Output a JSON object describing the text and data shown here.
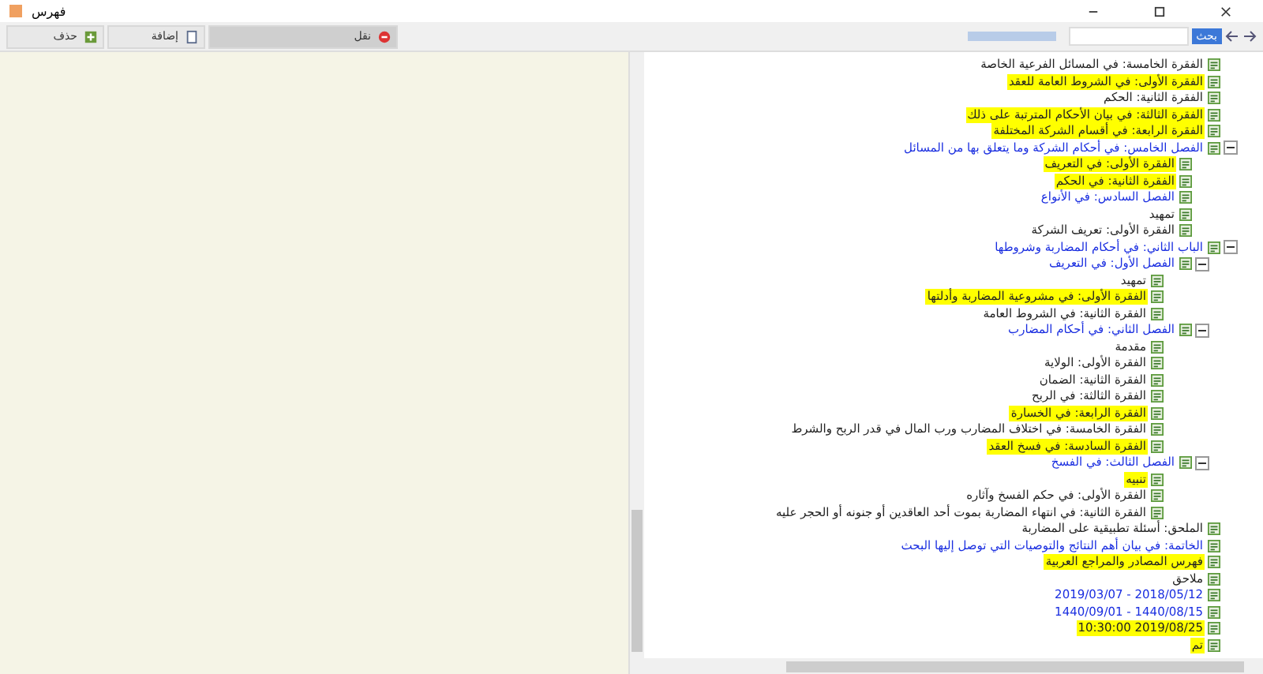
{
  "window": {
    "title": "فهرس"
  },
  "toolbar": {
    "buttons": [
      {
        "label": "نقل",
        "kind": "pressed"
      },
      {
        "label": "إضافة",
        "kind": "edit"
      },
      {
        "label": "حذف",
        "kind": "add"
      }
    ],
    "progress": {
      "level": 1
    },
    "find_label": "بحث"
  },
  "tree": {
    "items": [
      {
        "label": "الفقرة الخامسة: في المسائل الفرعية الخاصة",
        "kind": "text",
        "highlighted": false
      },
      {
        "label": "الفقرة الأولى: في الشروط العامة للعقد",
        "kind": "text",
        "highlighted": true
      },
      {
        "label": "الفقرة الثانية: الحكم",
        "kind": "text",
        "highlighted": false
      },
      {
        "label": "الفقرة الثالثة: في بيان الأحكام المترتبة على ذلك",
        "kind": "text",
        "highlighted": true
      },
      {
        "label": "الفقرة الرابعة: في أقسام الشركة المختلفة",
        "kind": "text",
        "highlighted": true
      },
      {
        "label": "الفصل الخامس: في أحكام الشركة وما يتعلق بها من المسائل",
        "kind": "heading",
        "highlighted": false,
        "expanded": true,
        "children": [
          {
            "label": "الفقرة الأولى: في التعريف",
            "kind": "text",
            "highlighted": true
          },
          {
            "label": "الفقرة الثانية: في الحكم",
            "kind": "text",
            "highlighted": true
          },
          {
            "label": "الفصل السادس: في الأنواع",
            "kind": "heading",
            "highlighted": false
          },
          {
            "label": "تمهيد",
            "kind": "text",
            "highlighted": false
          },
          {
            "label": "الفقرة الأولى: تعريف الشركة",
            "kind": "text",
            "highlighted": false
          }
        ]
      },
      {
        "label": "الباب الثاني: في أحكام المضاربة وشروطها",
        "kind": "heading",
        "highlighted": false,
        "expanded": true,
        "children": [
          {
            "label": "الفصل الأول: في التعريف",
            "kind": "heading",
            "highlighted": false,
            "expanded": true,
            "children": [
              {
                "label": "تمهيد",
                "kind": "text",
                "highlighted": false
              },
              {
                "label": "الفقرة الأولى: في مشروعية المضاربة وأدلتها",
                "kind": "text",
                "highlighted": true
              },
              {
                "label": "الفقرة الثانية: في الشروط العامة",
                "kind": "text",
                "highlighted": false
              }
            ]
          },
          {
            "label": "الفصل الثاني: في أحكام المضارب",
            "kind": "heading",
            "highlighted": false,
            "expanded": true,
            "children": [
              {
                "label": "مقدمة",
                "kind": "text",
                "highlighted": false
              },
              {
                "label": "الفقرة الأولى: الولاية",
                "kind": "text",
                "highlighted": false
              },
              {
                "label": "الفقرة الثانية: الضمان",
                "kind": "text",
                "highlighted": false
              },
              {
                "label": "الفقرة الثالثة: في الربح",
                "kind": "text",
                "highlighted": false
              },
              {
                "label": "الفقرة الرابعة: في الخسارة",
                "kind": "text",
                "highlighted": true
              },
              {
                "label": "الفقرة الخامسة: في اختلاف المضارب ورب المال في قدر الربح والشرط",
                "kind": "text",
                "highlighted": false
              },
              {
                "label": "الفقرة السادسة: في فسخ العقد",
                "kind": "text",
                "highlighted": true
              }
            ]
          },
          {
            "label": "الفصل الثالث: في الفسخ",
            "kind": "heading",
            "highlighted": false,
            "expanded": true,
            "children": [
              {
                "label": "تنبيه",
                "kind": "text",
                "highlighted": true
              },
              {
                "label": "الفقرة الأولى: في حكم الفسخ وآثاره",
                "kind": "text",
                "highlighted": false
              },
              {
                "label": "الفقرة الثانية: في انتهاء المضاربة بموت أحد العاقدين أو جنونه أو الحجر عليه",
                "kind": "text",
                "highlighted": false
              }
            ]
          }
        ]
      },
      {
        "label": "الملحق: أسئلة تطبيقية على المضاربة",
        "kind": "text",
        "highlighted": false
      },
      {
        "label": "الخاتمة: في بيان أهم النتائج والتوصيات التي توصل إليها البحث",
        "kind": "heading",
        "highlighted": false
      },
      {
        "label": "فهرس المصادر والمراجع العربية",
        "kind": "text",
        "highlighted": true
      },
      {
        "label": "ملاحق",
        "kind": "text",
        "highlighted": false
      },
      {
        "label": "2018/05/12 - 2019/03/07",
        "kind": "heading",
        "highlighted": false
      },
      {
        "label": "1440/08/15 - 1440/09/01",
        "kind": "heading",
        "highlighted": false
      },
      {
        "label": "2019/08/25 10:30:00",
        "kind": "text",
        "highlighted": true
      },
      {
        "label": "تم",
        "kind": "text",
        "highlighted": true
      }
    ]
  }
}
